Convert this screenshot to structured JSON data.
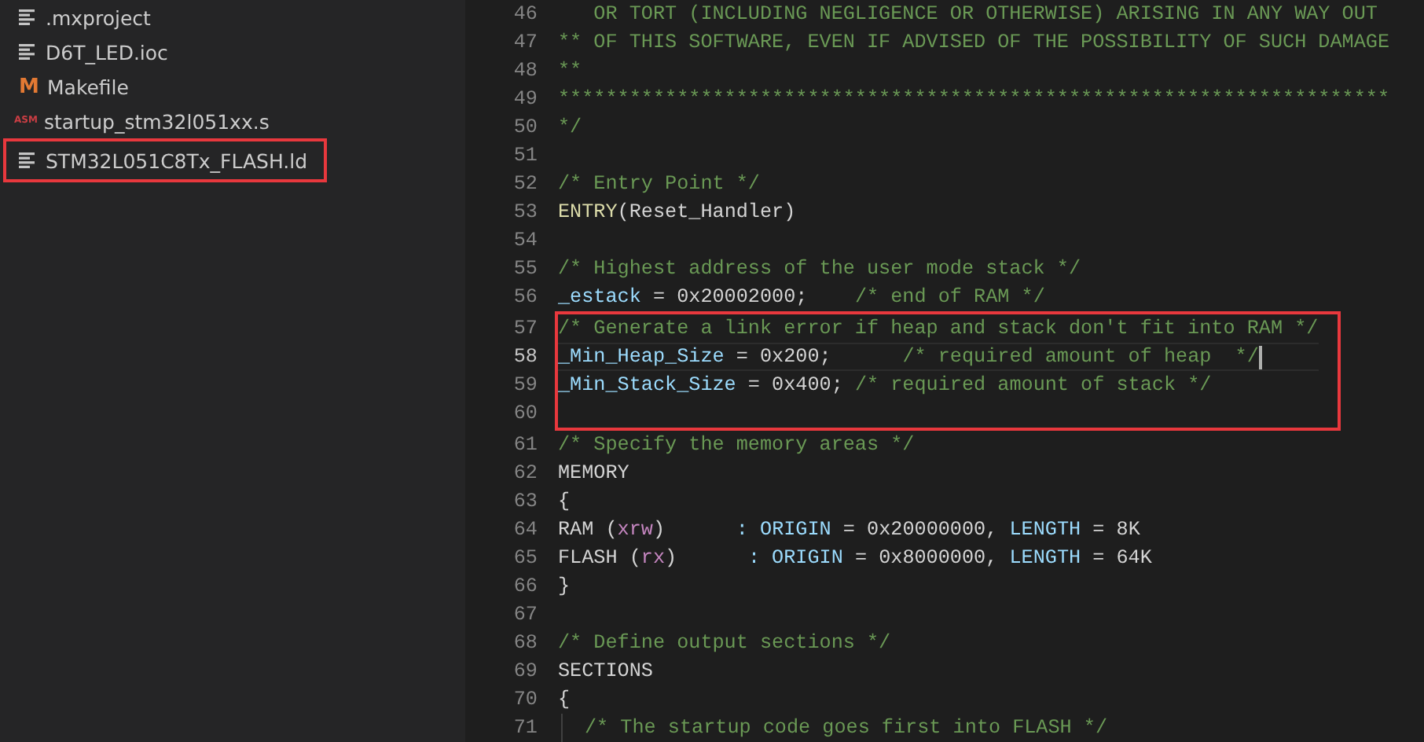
{
  "sidebar": {
    "files": [
      {
        "name": ".mxproject",
        "kind": "text",
        "highlighted": false
      },
      {
        "name": "D6T_LED.ioc",
        "kind": "text",
        "highlighted": false
      },
      {
        "name": "Makefile",
        "kind": "makefile",
        "icon_text": "M",
        "highlighted": false
      },
      {
        "name": "startup_stm32l051xx.s",
        "kind": "assembly",
        "icon_text": "ASM",
        "highlighted": false
      },
      {
        "name": "STM32L051C8Tx_FLASH.ld",
        "kind": "text",
        "highlighted": true
      }
    ]
  },
  "editor": {
    "lines": [
      {
        "number": "46",
        "current": false,
        "boxed": false,
        "tokens": [
          {
            "kind": "comment",
            "text": "   OR TORT (INCLUDING NEGLIGENCE OR OTHERWISE) ARISING IN ANY WAY OUT"
          }
        ]
      },
      {
        "number": "47",
        "current": false,
        "boxed": false,
        "tokens": [
          {
            "kind": "comment",
            "text": "** OF THIS SOFTWARE, EVEN IF ADVISED OF THE POSSIBILITY OF SUCH DAMAGE"
          }
        ]
      },
      {
        "number": "48",
        "current": false,
        "boxed": false,
        "tokens": [
          {
            "kind": "comment",
            "text": "**"
          }
        ]
      },
      {
        "number": "49",
        "current": false,
        "boxed": false,
        "tokens": [
          {
            "kind": "comment",
            "text": "**********************************************************************"
          }
        ]
      },
      {
        "number": "50",
        "current": false,
        "boxed": false,
        "tokens": [
          {
            "kind": "comment",
            "text": "*/"
          }
        ]
      },
      {
        "number": "51",
        "current": false,
        "boxed": false
      },
      {
        "number": "52",
        "current": false,
        "boxed": false,
        "tokens": [
          {
            "kind": "comment",
            "text": "/* Entry Point */"
          }
        ]
      },
      {
        "number": "53",
        "current": false,
        "boxed": false,
        "tokens": [
          {
            "kind": "function",
            "text": "ENTRY"
          },
          {
            "kind": "plain",
            "text": "(Reset_Handler)"
          }
        ]
      },
      {
        "number": "54",
        "current": false,
        "boxed": false
      },
      {
        "number": "55",
        "current": false,
        "boxed": false,
        "tokens": [
          {
            "kind": "comment",
            "text": "/* Highest address of the user mode stack */"
          }
        ]
      },
      {
        "number": "56",
        "current": false,
        "boxed": false,
        "tokens": [
          {
            "kind": "variable",
            "text": "_estack"
          },
          {
            "kind": "plain",
            "text": " = 0x20002000;    "
          },
          {
            "kind": "comment",
            "text": "/* end of RAM */"
          }
        ]
      },
      {
        "number": "57",
        "current": false,
        "boxed": true,
        "tokens": [
          {
            "kind": "comment",
            "text": "/* Generate a link error if heap and stack don't fit into RAM */"
          }
        ]
      },
      {
        "number": "58",
        "current": true,
        "boxed": true,
        "tokens": [
          {
            "kind": "variable",
            "text": "_Min_Heap_Size"
          },
          {
            "kind": "plain",
            "text": " = 0x200;      "
          },
          {
            "kind": "comment",
            "text": "/* required amount of heap  */"
          }
        ]
      },
      {
        "number": "59",
        "current": false,
        "boxed": true,
        "tokens": [
          {
            "kind": "variable",
            "text": "_Min_Stack_Size"
          },
          {
            "kind": "plain",
            "text": " = 0x400; "
          },
          {
            "kind": "comment",
            "text": "/* required amount of stack */"
          }
        ]
      },
      {
        "number": "60",
        "current": false,
        "boxed": true
      },
      {
        "number": "61",
        "current": false,
        "boxed": false,
        "tokens": [
          {
            "kind": "comment",
            "text": "/* Specify the memory areas */"
          }
        ]
      },
      {
        "number": "62",
        "current": false,
        "boxed": false,
        "tokens": [
          {
            "kind": "plain",
            "text": "MEMORY"
          }
        ]
      },
      {
        "number": "63",
        "current": false,
        "boxed": false,
        "tokens": [
          {
            "kind": "plain",
            "text": "{"
          }
        ]
      },
      {
        "number": "64",
        "current": false,
        "boxed": false,
        "tokens": [
          {
            "kind": "plain",
            "text": "RAM ("
          },
          {
            "kind": "attribute",
            "text": "xrw"
          },
          {
            "kind": "plain",
            "text": ")      "
          },
          {
            "kind": "variable",
            "text": ": ORIGIN"
          },
          {
            "kind": "plain",
            "text": " = 0x20000000, "
          },
          {
            "kind": "variable",
            "text": "LENGTH"
          },
          {
            "kind": "plain",
            "text": " = 8K"
          }
        ]
      },
      {
        "number": "65",
        "current": false,
        "boxed": false,
        "tokens": [
          {
            "kind": "plain",
            "text": "FLASH ("
          },
          {
            "kind": "attribute",
            "text": "rx"
          },
          {
            "kind": "plain",
            "text": ")      "
          },
          {
            "kind": "variable",
            "text": ": ORIGIN"
          },
          {
            "kind": "plain",
            "text": " = 0x8000000, "
          },
          {
            "kind": "variable",
            "text": "LENGTH"
          },
          {
            "kind": "plain",
            "text": " = 64K"
          }
        ]
      },
      {
        "number": "66",
        "current": false,
        "boxed": false,
        "tokens": [
          {
            "kind": "plain",
            "text": "}"
          }
        ]
      },
      {
        "number": "67",
        "current": false,
        "boxed": false
      },
      {
        "number": "68",
        "current": false,
        "boxed": false,
        "tokens": [
          {
            "kind": "comment",
            "text": "/* Define output sections */"
          }
        ]
      },
      {
        "number": "69",
        "current": false,
        "boxed": false,
        "tokens": [
          {
            "kind": "plain",
            "text": "SECTIONS"
          }
        ]
      },
      {
        "number": "70",
        "current": false,
        "boxed": false,
        "tokens": [
          {
            "kind": "plain",
            "text": "{"
          }
        ]
      },
      {
        "number": "71",
        "current": false,
        "boxed": false,
        "indented": true,
        "tokens": [
          {
            "kind": "comment",
            "text": "/* The startup code goes first into FLASH */"
          }
        ]
      }
    ]
  }
}
